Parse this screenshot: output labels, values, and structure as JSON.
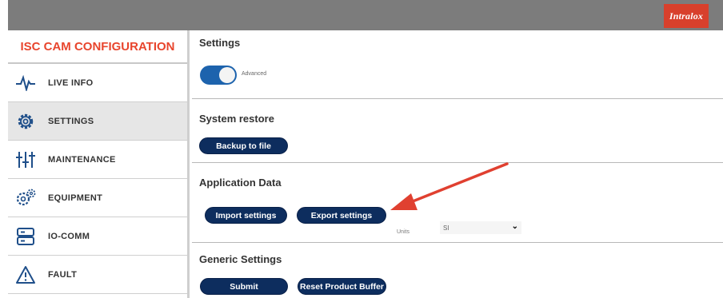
{
  "header": {
    "logo_text": "Intralox",
    "logo_color": "#d8402c",
    "bar_color": "#7c7c7c"
  },
  "sidebar": {
    "title": "ISC CAM CONFIGURATION",
    "items": [
      {
        "label": "LIVE INFO",
        "icon": "pulse-icon"
      },
      {
        "label": "SETTINGS",
        "icon": "gear-icon",
        "active": true
      },
      {
        "label": "MAINTENANCE",
        "icon": "sliders-icon"
      },
      {
        "label": "EQUIPMENT",
        "icon": "gears-icon"
      },
      {
        "label": "IO-COMM",
        "icon": "server-icon"
      },
      {
        "label": "FAULT",
        "icon": "warning-icon"
      }
    ]
  },
  "main": {
    "settings": {
      "title": "Settings",
      "toggle_label": "Advanced",
      "toggle_on": true
    },
    "system_restore": {
      "title": "System restore",
      "backup_label": "Backup to file"
    },
    "application_data": {
      "title": "Application Data",
      "import_label": "Import settings",
      "export_label": "Export settings",
      "unit_label": "Units",
      "unit_value": "SI"
    },
    "generic_settings": {
      "title": "Generic Settings",
      "submit_label": "Submit",
      "reset_label": "Reset Product Buffer"
    }
  },
  "colors": {
    "accent": "#e8452d",
    "button": "#0d2d5e",
    "toggle": "#1d63ad",
    "arrow": "#e04030"
  }
}
